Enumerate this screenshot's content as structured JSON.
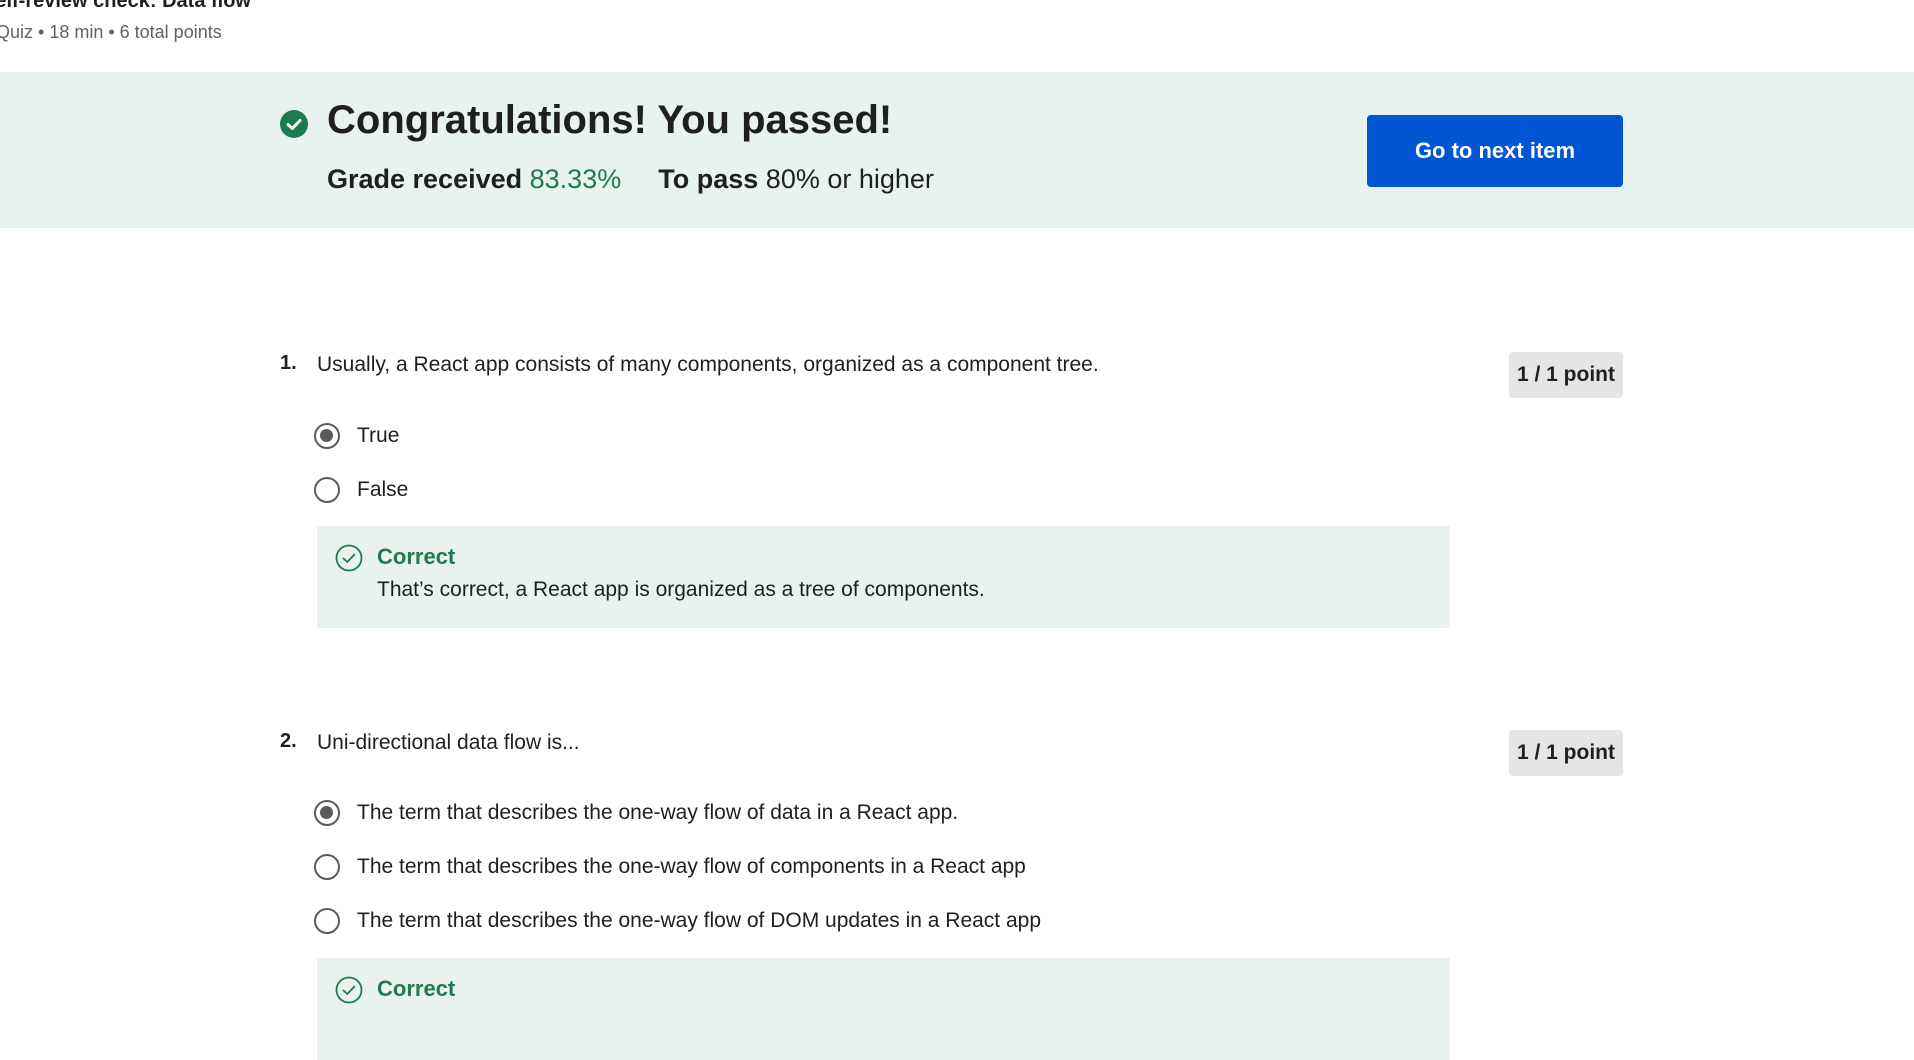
{
  "header": {
    "title": "Self-review check: Data flow",
    "meta": "Quiz • 18 min • 6 total points"
  },
  "banner": {
    "title": "Congratulations! You passed!",
    "grade_label": "Grade received",
    "grade_value": "83.33%",
    "pass_label": "To pass",
    "pass_value": "80% or higher",
    "next_button": "Go to next item",
    "success_color": "#1e7a4f",
    "button_color": "#0056d2"
  },
  "questions": [
    {
      "number": "1.",
      "text": "Usually, a React app consists of many components, organized as a component tree.",
      "points": "1 / 1 point",
      "options": [
        {
          "label": "True",
          "selected": true
        },
        {
          "label": "False",
          "selected": false
        }
      ],
      "feedback": {
        "title": "Correct",
        "text": "That’s correct, a React app is organized as a tree of components."
      }
    },
    {
      "number": "2.",
      "text": "Uni-directional data flow is...",
      "points": "1 / 1 point",
      "options": [
        {
          "label": "The term that describes the one-way flow of data in a React app.",
          "selected": true
        },
        {
          "label": "The term that describes the one-way flow of components in a React app",
          "selected": false
        },
        {
          "label": "The term that describes the one-way flow of DOM updates in a React app",
          "selected": false
        }
      ],
      "feedback": {
        "title": "Correct"
      }
    }
  ]
}
